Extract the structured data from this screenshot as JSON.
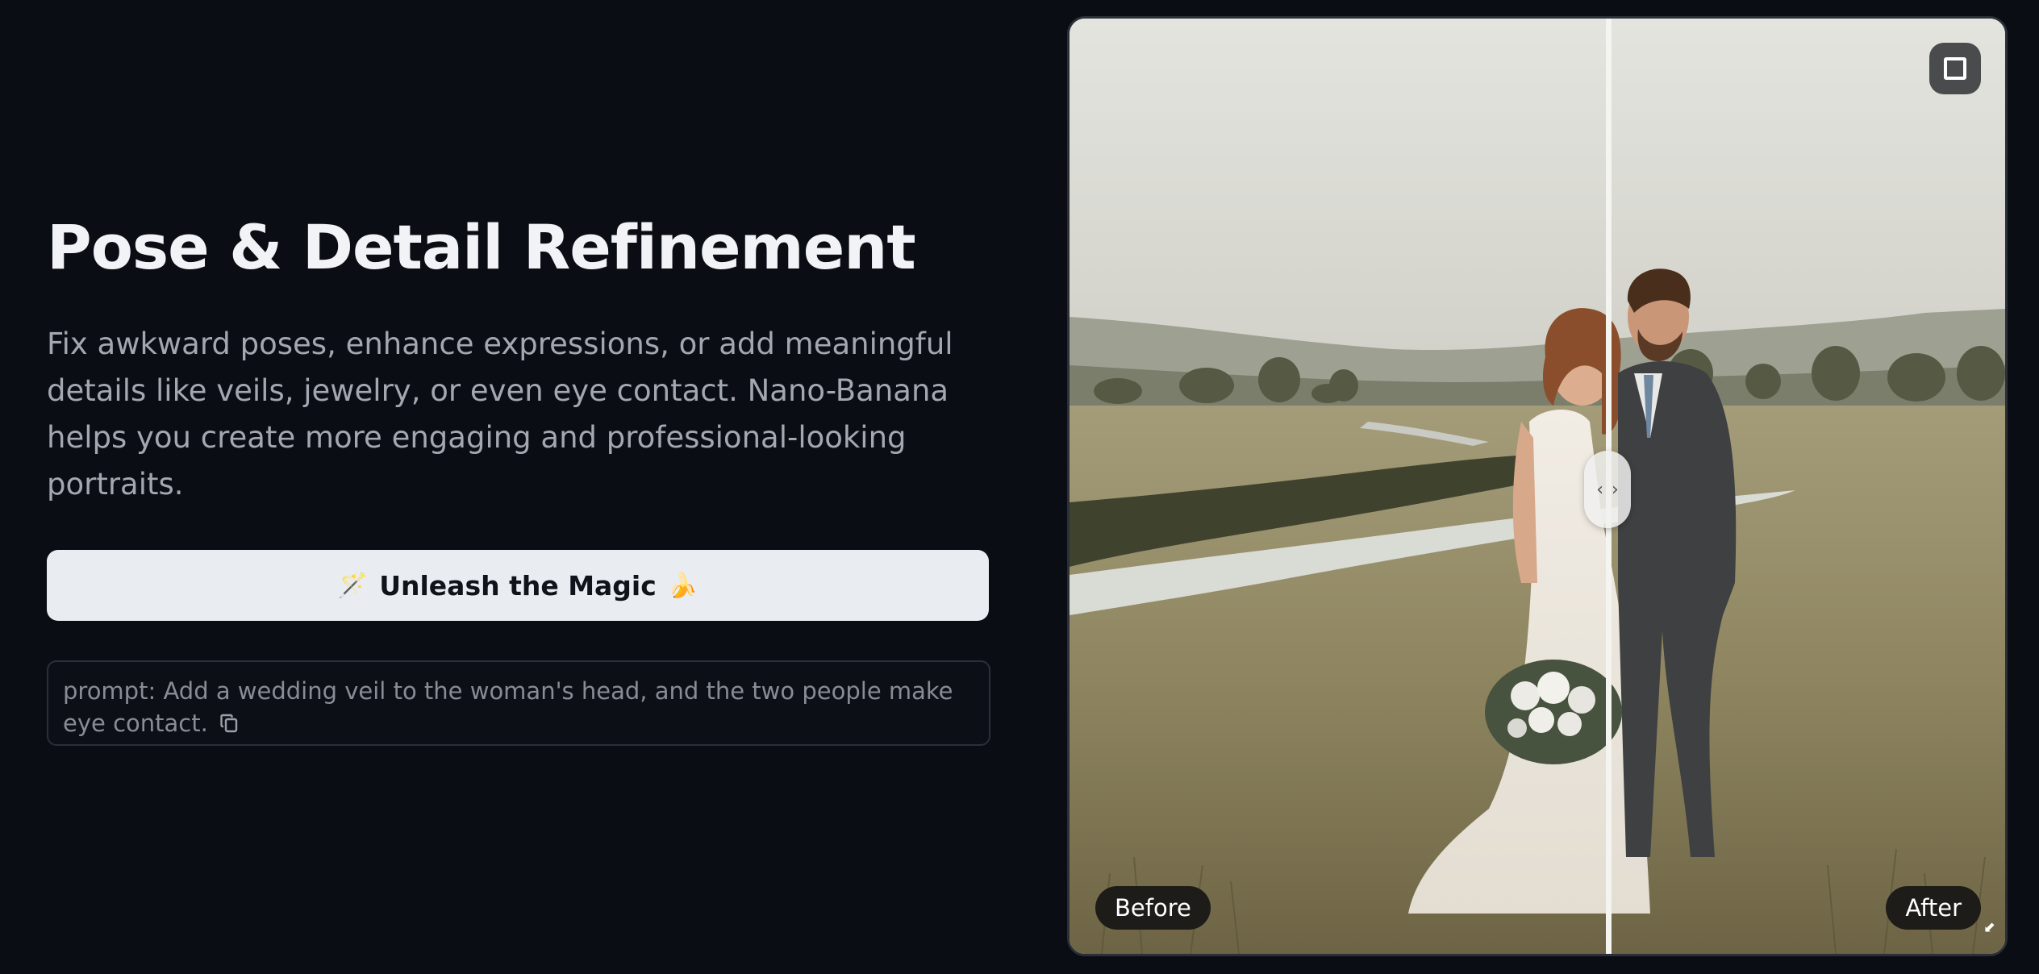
{
  "hero": {
    "title": "Pose & Detail Refinement",
    "description": "Fix awkward poses, enhance expressions, or add meaningful details like veils, jewelry, or even eye contact. Nano-Banana helps you create more engaging and professional-looking portraits.",
    "cta_label": "Unleash the Magic",
    "cta_icon_left": "🪄",
    "cta_icon_right": "🍌",
    "prompt_text": "prompt: Add a wedding veil to the woman's head, and the two people make eye contact."
  },
  "compare": {
    "before_label": "Before",
    "after_label": "After",
    "handle_left": "‹",
    "handle_right": "›",
    "corner_mark": "⬋"
  },
  "icons": {
    "copy": "copy-icon",
    "fullscreen": "fullscreen-icon",
    "magic_wand": "magic-wand-icon",
    "banana": "banana-icon"
  },
  "colors": {
    "background": "#0a0d13",
    "title": "#f1f3f7",
    "body_text": "#a2a7b0",
    "cta_bg": "#e9ecf1",
    "prompt_border": "#2a2f38"
  }
}
